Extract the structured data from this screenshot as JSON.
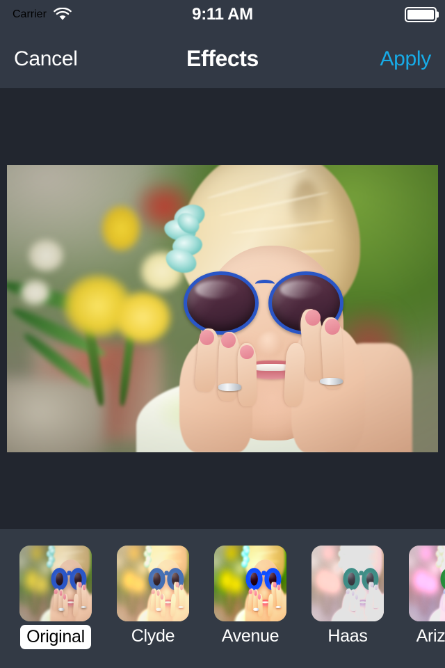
{
  "status_bar": {
    "carrier": "Carrier",
    "wifi_icon": "wifi-icon",
    "time": "9:11 AM",
    "battery_icon": "battery-full-icon",
    "battery_level": 100
  },
  "nav_bar": {
    "cancel_label": "Cancel",
    "title": "Effects",
    "apply_label": "Apply",
    "apply_color": "#17ace8",
    "background_color": "#323945"
  },
  "preview": {
    "alt": "Portrait of a blonde woman wearing large blue sunglasses, resting her chin on her hands, with yellow daffodils and green garden background",
    "selected_effect": "Original"
  },
  "filter_strip": {
    "background_color": "#333a45",
    "items": [
      {
        "label": "Original",
        "effect_class": "fx-original",
        "selected": true
      },
      {
        "label": "Clyde",
        "effect_class": "fx-clyde",
        "selected": false
      },
      {
        "label": "Avenue",
        "effect_class": "fx-avenue",
        "selected": false
      },
      {
        "label": "Haas",
        "effect_class": "fx-haas",
        "selected": false
      },
      {
        "label": "Arizona",
        "effect_class": "fx-arizona",
        "selected": false
      }
    ]
  },
  "theme": {
    "canvas_background": "#22262f",
    "text_primary": "#ffffff",
    "accent": "#17ace8"
  }
}
